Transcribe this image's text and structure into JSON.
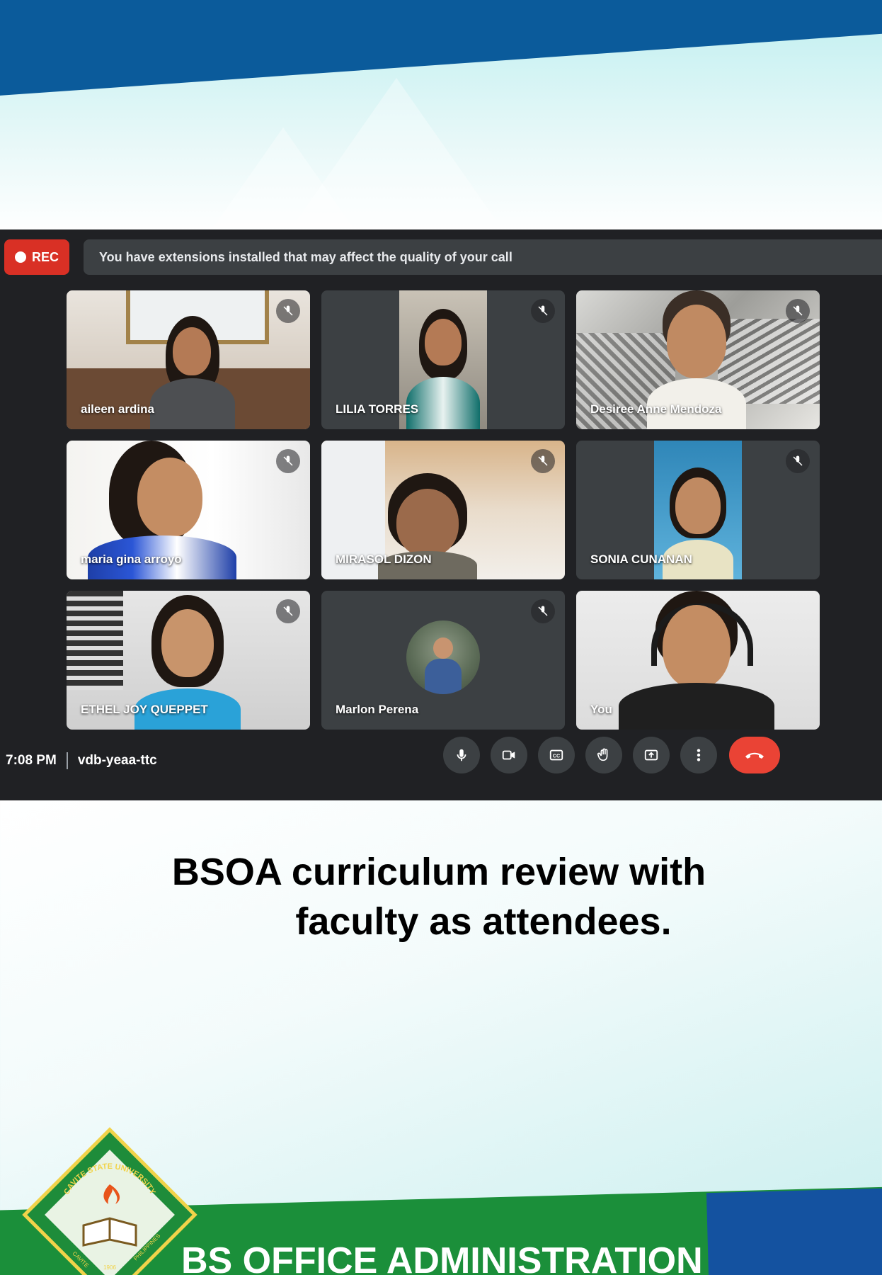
{
  "meet": {
    "rec_label": "REC",
    "notice": "You have extensions installed that may affect the quality of your call",
    "participants": [
      {
        "name": "aileen ardina",
        "muted": true
      },
      {
        "name": "LILIA TORRES",
        "muted": true
      },
      {
        "name": "Desiree Anne Mendoza",
        "muted": true
      },
      {
        "name": "maria gina arroyo",
        "muted": true
      },
      {
        "name": "MIRASOL DIZON",
        "muted": true
      },
      {
        "name": "SONIA CUNANAN",
        "muted": true
      },
      {
        "name": "ETHEL JOY QUEPPET",
        "muted": true
      },
      {
        "name": "Marlon Perena",
        "muted": true
      },
      {
        "name": "You",
        "muted": false
      }
    ],
    "time": "7:08 PM",
    "meeting_code": "vdb-yeaa-ttc",
    "controls": [
      "microphone-icon",
      "camera-icon",
      "captions-icon",
      "raise-hand-icon",
      "present-icon",
      "more-options-icon",
      "end-call-icon"
    ],
    "colors": {
      "background": "#202124",
      "tile": "#3c4043",
      "rec": "#d93025",
      "hangup": "#ea4335"
    }
  },
  "caption": {
    "line1": "BSOA curriculum review with",
    "line2": "faculty as attendees."
  },
  "footer": {
    "program_title": "BS OFFICE ADMINISTRATION",
    "logo_text": {
      "top": "CAVITE STATE UNIVERSITY",
      "left": "CAVITE",
      "right": "PHILIPPINES",
      "year": "1906"
    },
    "colors": {
      "green": "#1b8f3a",
      "blue": "#1452a0"
    }
  }
}
